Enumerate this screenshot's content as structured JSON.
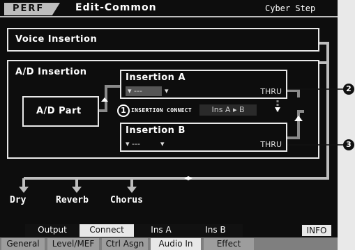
{
  "header": {
    "mode_tab": "PERF",
    "screen_title": "Edit-Common",
    "performance_name": "Cyber Step"
  },
  "voice_insertion": {
    "label": "Voice Insertion"
  },
  "ad_insertion": {
    "label": "A/D Insertion",
    "part_label": "A/D Part",
    "insertion_a": {
      "title": "Insertion A",
      "category": "---",
      "effect": "THRU"
    },
    "insertion_b": {
      "title": "Insertion B",
      "category": "---",
      "effect": "THRU"
    },
    "insertion_connect": {
      "label": "INSERTION CONNECT",
      "value": "Ins A ▸ B"
    }
  },
  "outputs": {
    "dry": "Dry",
    "reverb": "Reverb",
    "chorus": "Chorus"
  },
  "sub_tabs": [
    "Output",
    "Connect",
    "Ins A",
    "Ins B"
  ],
  "sub_tab_active": "Connect",
  "info_button": "INFO",
  "main_tabs": [
    "General",
    "Level/MEF",
    "Ctrl Asgn",
    "Audio In",
    "Effect"
  ],
  "main_tab_active": "Audio In",
  "callouts": {
    "c1": "1",
    "c2": "2",
    "c3": "3"
  },
  "colors": {
    "lcd_bg": "#0d0d0d",
    "line": "#e8e8e8",
    "grey_line": "#8a8a8a",
    "highlight": "#bdbdbd"
  }
}
